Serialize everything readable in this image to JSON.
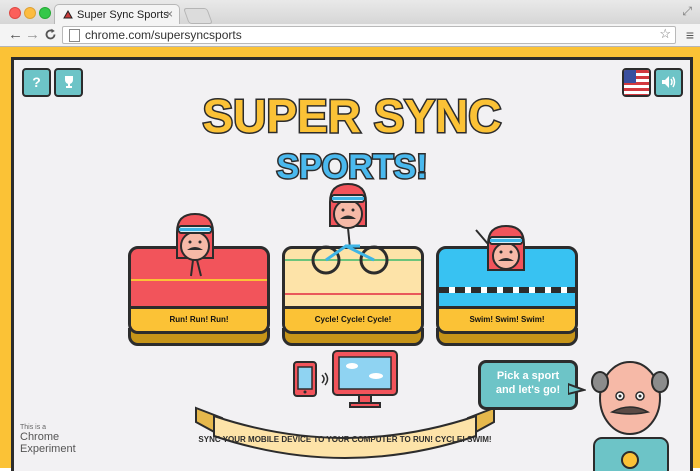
{
  "browser": {
    "tab_title": "Super Sync Sports",
    "tab_close": "×",
    "url": "chrome.com/supersyncsports",
    "back": "←",
    "forward": "→",
    "reload": "C",
    "star": "☆",
    "menu": "≡",
    "fullscreen": "⤢"
  },
  "game": {
    "title_line1": "SUPER SYNC",
    "title_line2": "SPORTS!",
    "help_label": "?",
    "trophy_label": "🏆",
    "sound_label": "🔊",
    "flag_name": "us-flag-icon",
    "sports": [
      {
        "label": "Run! Run! Run!",
        "color": "#f2545b"
      },
      {
        "label": "Cycle! Cycle! Cycle!",
        "color": "#fde3a8"
      },
      {
        "label": "Swim! Swim! Swim!",
        "color": "#38c2f2"
      }
    ],
    "speech": "Pick a sport and let's go!",
    "banner_text": "SYNC YOUR MOBILE DEVICE TO YOUR COMPUTER TO RUN! CYCLE! SWIM!",
    "experiment_small": "This is a",
    "experiment_line1": "Chrome",
    "experiment_line2": "Experiment"
  },
  "colors": {
    "background": "#fbc236",
    "stage": "#f2f1f3",
    "teal": "#6dc4c7",
    "outline": "#2c2c2c"
  }
}
